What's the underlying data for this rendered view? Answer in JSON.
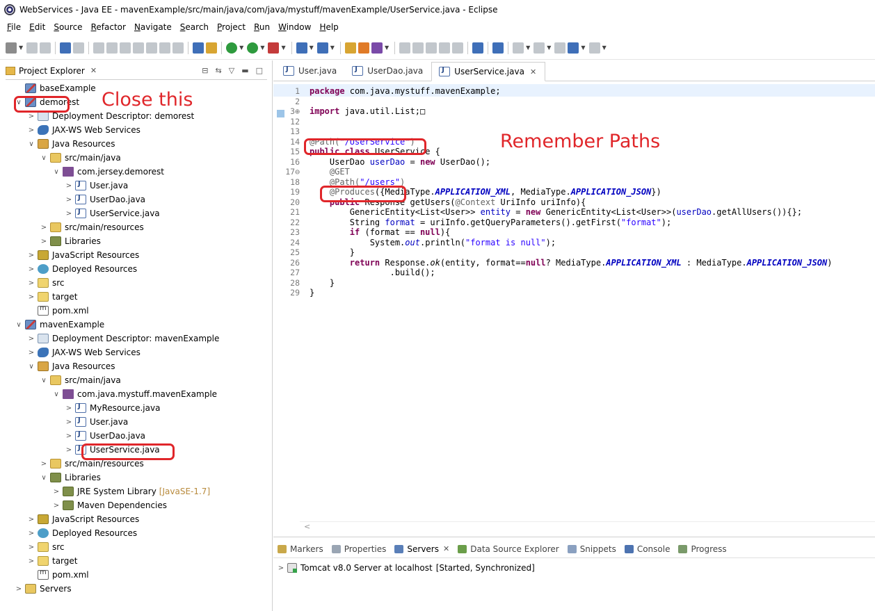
{
  "window": {
    "title": "WebServices - Java EE - mavenExample/src/main/java/com/java/mystuff/mavenExample/UserService.java - Eclipse"
  },
  "menubar": {
    "items": [
      "File",
      "Edit",
      "Source",
      "Refactor",
      "Navigate",
      "Search",
      "Project",
      "Run",
      "Window",
      "Help"
    ]
  },
  "explorer": {
    "tab_label": "Project Explorer",
    "tab_close": "✕",
    "tree": [
      {
        "label": "baseExample",
        "icon": "project-icon",
        "depth": 0,
        "chevron": ""
      },
      {
        "label": "demorest",
        "icon": "project-icon",
        "depth": 0,
        "chevron": "∨"
      },
      {
        "label": "Deployment Descriptor: demorest",
        "icon": "descriptor-icon",
        "depth": 1,
        "chevron": ">"
      },
      {
        "label": "JAX-WS Web Services",
        "icon": "webservice-icon",
        "depth": 1,
        "chevron": ">"
      },
      {
        "label": "Java Resources",
        "icon": "java-resources-icon",
        "depth": 1,
        "chevron": "∨"
      },
      {
        "label": "src/main/java",
        "icon": "source-folder-icon",
        "depth": 2,
        "chevron": "∨"
      },
      {
        "label": "com.jersey.demorest",
        "icon": "package-icon",
        "depth": 3,
        "chevron": "∨"
      },
      {
        "label": "User.java",
        "icon": "java-file-icon",
        "depth": 4,
        "chevron": ">"
      },
      {
        "label": "UserDao.java",
        "icon": "java-file-icon",
        "depth": 4,
        "chevron": ">"
      },
      {
        "label": "UserService.java",
        "icon": "java-file-icon",
        "depth": 4,
        "chevron": ">"
      },
      {
        "label": "src/main/resources",
        "icon": "source-folder-icon",
        "depth": 2,
        "chevron": ">"
      },
      {
        "label": "Libraries",
        "icon": "library-icon",
        "depth": 2,
        "chevron": ">"
      },
      {
        "label": "JavaScript Resources",
        "icon": "javascript-resources-icon",
        "depth": 1,
        "chevron": ">"
      },
      {
        "label": "Deployed Resources",
        "icon": "deployed-resources-icon",
        "depth": 1,
        "chevron": ">"
      },
      {
        "label": "src",
        "icon": "src-folder-icon",
        "depth": 1,
        "chevron": ">"
      },
      {
        "label": "target",
        "icon": "folder-icon",
        "depth": 1,
        "chevron": ">"
      },
      {
        "label": "pom.xml",
        "icon": "pom-file-icon",
        "depth": 1,
        "chevron": ""
      },
      {
        "label": "mavenExample",
        "icon": "project-icon",
        "depth": 0,
        "chevron": "∨"
      },
      {
        "label": "Deployment Descriptor: mavenExample",
        "icon": "descriptor-icon",
        "depth": 1,
        "chevron": ">"
      },
      {
        "label": "JAX-WS Web Services",
        "icon": "webservice-icon",
        "depth": 1,
        "chevron": ">"
      },
      {
        "label": "Java Resources",
        "icon": "java-resources-icon",
        "depth": 1,
        "chevron": "∨"
      },
      {
        "label": "src/main/java",
        "icon": "source-folder-icon",
        "depth": 2,
        "chevron": "∨"
      },
      {
        "label": "com.java.mystuff.mavenExample",
        "icon": "package-icon",
        "depth": 3,
        "chevron": "∨"
      },
      {
        "label": "MyResource.java",
        "icon": "java-file-icon",
        "depth": 4,
        "chevron": ">"
      },
      {
        "label": "User.java",
        "icon": "java-file-icon",
        "depth": 4,
        "chevron": ">"
      },
      {
        "label": "UserDao.java",
        "icon": "java-file-icon",
        "depth": 4,
        "chevron": ">"
      },
      {
        "label": "UserService.java",
        "icon": "java-file-icon",
        "depth": 4,
        "chevron": ">"
      },
      {
        "label": "src/main/resources",
        "icon": "source-folder-icon",
        "depth": 2,
        "chevron": ">"
      },
      {
        "label": "Libraries",
        "icon": "library-icon",
        "depth": 2,
        "chevron": "∨"
      },
      {
        "label": "JRE System Library",
        "icon": "library-icon",
        "depth": 3,
        "chevron": ">",
        "decoration": "[JavaSE-1.7]"
      },
      {
        "label": "Maven Dependencies",
        "icon": "library-icon",
        "depth": 3,
        "chevron": ">"
      },
      {
        "label": "JavaScript Resources",
        "icon": "javascript-resources-icon",
        "depth": 1,
        "chevron": ">"
      },
      {
        "label": "Deployed Resources",
        "icon": "deployed-resources-icon",
        "depth": 1,
        "chevron": ">"
      },
      {
        "label": "src",
        "icon": "src-folder-icon",
        "depth": 1,
        "chevron": ">"
      },
      {
        "label": "target",
        "icon": "folder-icon",
        "depth": 1,
        "chevron": ">"
      },
      {
        "label": "pom.xml",
        "icon": "pom-file-icon",
        "depth": 1,
        "chevron": ""
      },
      {
        "label": "Servers",
        "icon": "servers-folder-icon",
        "depth": 0,
        "chevron": ">"
      }
    ]
  },
  "annotations": {
    "close_this": "Close this",
    "remember_paths": "Remember Paths",
    "color": "#e0262a"
  },
  "editor": {
    "tabs": [
      {
        "label": "User.java",
        "active": false
      },
      {
        "label": "UserDao.java",
        "active": false
      },
      {
        "label": "UserService.java",
        "active": true
      }
    ],
    "tab_close": "✕",
    "line_numbers": [
      "1",
      "2",
      "3⊕",
      "12",
      "13",
      "14",
      "15",
      "16",
      "17⊖",
      "18",
      "19",
      "20",
      "21",
      "22",
      "23",
      "24",
      "25",
      "26",
      "27",
      "28",
      "29"
    ],
    "code": {
      "l1_kw": "package",
      "l1_rest": " com.java.mystuff.mavenExample;",
      "l3_kw": "import",
      "l3_rest": " java.util.List;",
      "l3_fold": "□",
      "l14_ann": "@Path(",
      "l14_str": "\"/UserService\"",
      "l14_close": ")",
      "l15_kw1": "public",
      "l15_kw2": "class",
      "l15_rest": " UserService {",
      "l16_a": "    UserDao ",
      "l16_fld": "userDao",
      "l16_b": " = ",
      "l16_kw": "new",
      "l16_c": " UserDao();",
      "l17_ann": "    @GET",
      "l18_ann": "    @Path(",
      "l18_str": "\"/users\"",
      "l18_close": ")",
      "l19_ann": "    @Produces",
      "l19_a": "({MediaType.",
      "l19_c1": "APPLICATION_XML",
      "l19_b": ", MediaType.",
      "l19_c2": "APPLICATION_JSON",
      "l19_d": "})",
      "l20_kw": "    public",
      "l20_a": " Response getUsers(",
      "l20_ann": "@Context",
      "l20_b": " UriInfo uriInfo){",
      "l21_a": "        GenericEntity<List<User>> ",
      "l21_var": "entity",
      "l21_b": " = ",
      "l21_kw": "new",
      "l21_c": " GenericEntity<List<User>>(",
      "l21_fld": "userDao",
      "l21_d": ".getAllUsers()){};",
      "l22_a": "        String ",
      "l22_var": "format",
      "l22_b": " = uriInfo.getQueryParameters().getFirst(",
      "l22_str": "\"format\"",
      "l22_c": ");",
      "l23_kw": "        if",
      "l23_a": " (format == ",
      "l23_kw2": "null",
      "l23_b": "){",
      "l24_a": "            System.",
      "l24_fld": "out",
      "l24_b": ".println(",
      "l24_str": "\"format is null\"",
      "l24_c": ");",
      "l25": "        }",
      "l26_kw": "        return",
      "l26_a": " Response.",
      "l26_it": "ok",
      "l26_b": "(entity, format==",
      "l26_kw2": "null",
      "l26_c": "? MediaType.",
      "l26_c1": "APPLICATION_XML",
      "l26_d": " : MediaType.",
      "l26_c2": "APPLICATION_JSON",
      "l26_e": ")",
      "l27": "                .build();",
      "l28": "    }",
      "l29": "}"
    }
  },
  "bottom_panel": {
    "tabs": [
      {
        "label": "Markers",
        "icon": "markers-icon",
        "active": false
      },
      {
        "label": "Properties",
        "icon": "properties-icon",
        "active": false
      },
      {
        "label": "Servers",
        "icon": "servers-icon",
        "active": true
      },
      {
        "label": "Data Source Explorer",
        "icon": "data-source-icon",
        "active": false
      },
      {
        "label": "Snippets",
        "icon": "snippets-icon",
        "active": false
      },
      {
        "label": "Console",
        "icon": "console-icon",
        "active": false
      },
      {
        "label": "Progress",
        "icon": "progress-icon",
        "active": false
      }
    ],
    "tab_close": "✕",
    "server": {
      "chevron": ">",
      "label": "Tomcat v8.0 Server at localhost",
      "status": "[Started, Synchronized]"
    }
  }
}
